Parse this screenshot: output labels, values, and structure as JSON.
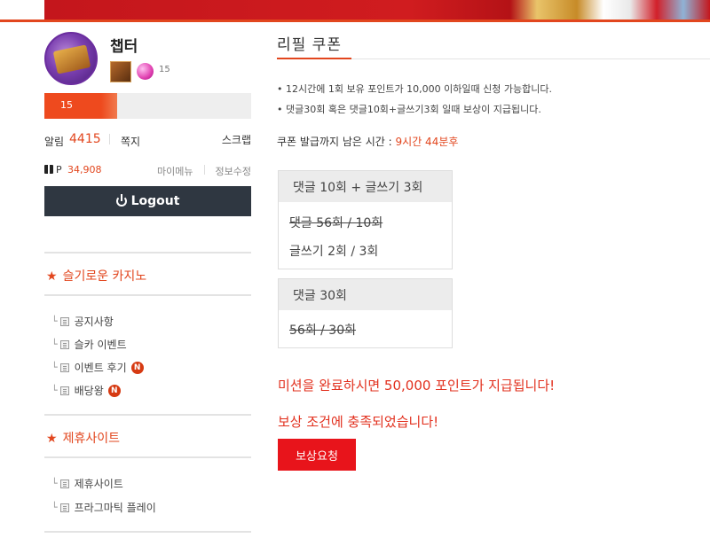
{
  "profile": {
    "username": "챕터",
    "level": "15",
    "level_bar_text": "15",
    "level_progress_percent": 35
  },
  "account": {
    "alarm_label": "알림",
    "alarm_count": "4415",
    "memo_label": "쪽지",
    "scrap_label": "스크랩",
    "point_label": "P",
    "point_value": "34,908",
    "mymenu_label": "마이메뉴",
    "edit_info_label": "정보수정",
    "logout_label": "Logout"
  },
  "sidebar": {
    "categories": [
      {
        "title": "슬기로운 카지노",
        "items": [
          {
            "label": "공지사항",
            "new": false
          },
          {
            "label": "슬카 이벤트",
            "new": false
          },
          {
            "label": "이벤트 후기",
            "new": true
          },
          {
            "label": "배당왕",
            "new": true
          }
        ]
      },
      {
        "title": "제휴사이트",
        "items": [
          {
            "label": "제휴사이트",
            "new": false
          },
          {
            "label": "프라그마틱 플레이",
            "new": false
          }
        ]
      }
    ],
    "new_badge_text": "N"
  },
  "main": {
    "title": "리필 쿠폰",
    "rules": [
      "• 12시간에 1회 보유 포인트가 10,000 이하일때 신청 가능합니다.",
      "• 댓글30회 혹은 댓글10회+글쓰기3회 일때 보상이 지급됩니다."
    ],
    "timer_label": "쿠폰 발급까지 남은 시간 : ",
    "timer_value": "9시간 44분후",
    "card1": {
      "title": "댓글 10회 + 글쓰기 3회",
      "row1": "댓글 56회 / 10회",
      "row2": "글쓰기 2회 / 3회"
    },
    "card2": {
      "title": "댓글 30회",
      "row1": "56회 / 30회"
    },
    "mission_message": "미션을 완료하시면 50,000 포인트가 지급됩니다!",
    "status_message": "보상 조건에 충족되었습니다!",
    "reward_button": "보상요청"
  },
  "colors": {
    "accent": "#e2461e",
    "button_red": "#e8141b",
    "logout_bg": "#2f3741"
  }
}
